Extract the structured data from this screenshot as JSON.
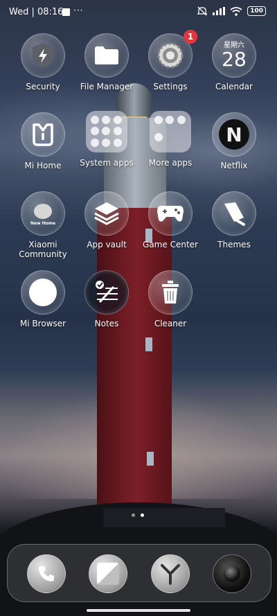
{
  "status": {
    "time": "Wed | 08:16",
    "more": "···",
    "battery": "100"
  },
  "apps": [
    {
      "label": "Security",
      "icon": "shield-lightning-icon"
    },
    {
      "label": "File Manager",
      "icon": "folder-icon"
    },
    {
      "label": "Settings",
      "icon": "gear-icon",
      "badge": "1"
    },
    {
      "label": "Calendar",
      "icon": "calendar-icon",
      "weekday": "星期六",
      "day": "28"
    },
    {
      "label": "Mi Home",
      "icon": "mi-home-icon"
    },
    {
      "label": "System apps",
      "icon": "folder-system-apps"
    },
    {
      "label": "More apps",
      "icon": "folder-more-apps"
    },
    {
      "label": "Netflix",
      "icon": "netflix-icon",
      "glyph": "N"
    },
    {
      "label": "Xiaomi Community",
      "icon": "xiaomi-community-icon",
      "sub": "New Home"
    },
    {
      "label": "App vault",
      "icon": "layers-icon"
    },
    {
      "label": "Game Center",
      "icon": "gamepad-icon"
    },
    {
      "label": "Themes",
      "icon": "brush-icon"
    },
    {
      "label": "Mi Browser",
      "icon": "browser-icon"
    },
    {
      "label": "Notes",
      "icon": "notes-icon"
    },
    {
      "label": "Cleaner",
      "icon": "trash-icon"
    }
  ],
  "dock": [
    {
      "name": "Phone",
      "icon": "phone-icon"
    },
    {
      "name": "Messaging",
      "icon": "message-icon"
    },
    {
      "name": "Yandex Browser",
      "icon": "yandex-icon"
    },
    {
      "name": "Camera",
      "icon": "camera-icon"
    }
  ],
  "page_indicator": {
    "pages": 2,
    "active": 2
  }
}
